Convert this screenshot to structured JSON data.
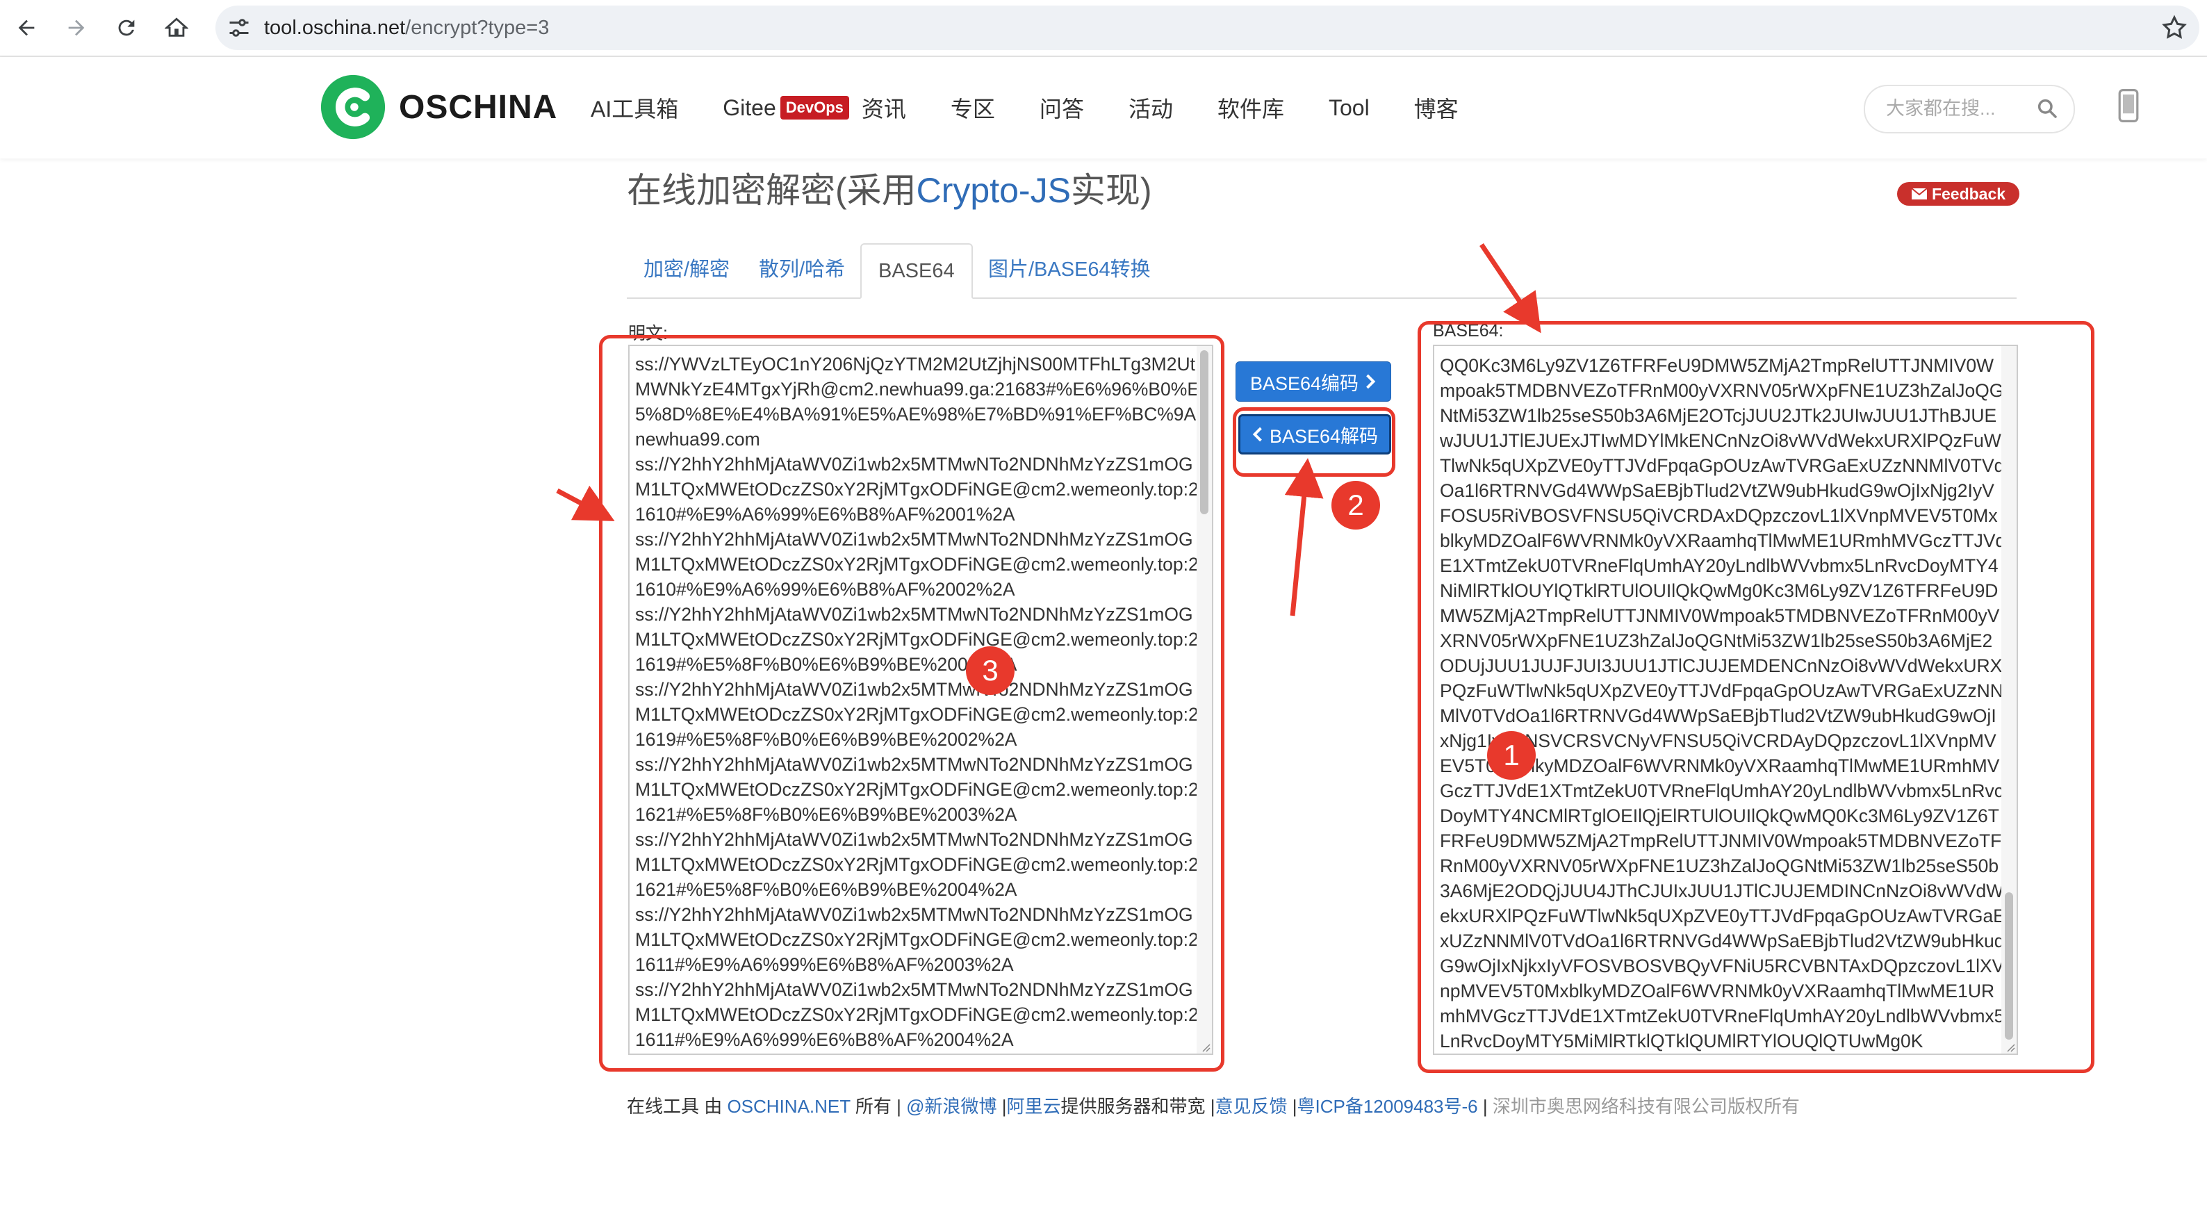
{
  "browser": {
    "url_host": "tool.oschina.net",
    "url_path": "/encrypt?type=3"
  },
  "site": {
    "logo_text": "OSCHINA",
    "nav": [
      {
        "label": "AI工具箱"
      },
      {
        "label": "Gitee",
        "badge": "DevOps"
      },
      {
        "label": "资讯"
      },
      {
        "label": "专区"
      },
      {
        "label": "问答"
      },
      {
        "label": "活动"
      },
      {
        "label": "软件库"
      },
      {
        "label": "Tool"
      },
      {
        "label": "博客"
      }
    ],
    "search_placeholder": "大家都在搜..."
  },
  "page": {
    "title_prefix": "在线加密解密(采用",
    "title_highlight": "Crypto-JS",
    "title_suffix": "实现)",
    "feedback_label": "Feedback",
    "tabs": [
      {
        "label": "加密/解密",
        "active": false
      },
      {
        "label": "散列/哈希",
        "active": false
      },
      {
        "label": "BASE64",
        "active": true
      },
      {
        "label": "图片/BASE64转换",
        "active": false
      }
    ],
    "plaintext_label": "明文:",
    "base64_label": "BASE64:",
    "encode_button": "BASE64编码",
    "decode_button": "BASE64解码",
    "plaintext_lines": [
      "ss://YWVzLTEyOC1nY206NjQzYTM2M2UtZjhjNS00MTFhLTg3M2Ut",
      "MWNkYzE4MTgxYjRh@cm2.newhua99.ga:21683#%E6%96%B0%E",
      "5%8D%8E%E4%BA%91%E5%AE%98%E7%BD%91%EF%BC%9A",
      "newhua99.com",
      "ss://Y2hhY2hhMjAtaWV0Zi1wb2x5MTMwNTo2NDNhMzYzZS1mOG",
      "M1LTQxMWEtODczZS0xY2RjMTgxODFiNGE@cm2.wemeonly.top:2",
      "1610#%E9%A6%99%E6%B8%AF%2001%2A",
      "ss://Y2hhY2hhMjAtaWV0Zi1wb2x5MTMwNTo2NDNhMzYzZS1mOG",
      "M1LTQxMWEtODczZS0xY2RjMTgxODFiNGE@cm2.wemeonly.top:2",
      "1610#%E9%A6%99%E6%B8%AF%2002%2A",
      "ss://Y2hhY2hhMjAtaWV0Zi1wb2x5MTMwNTo2NDNhMzYzZS1mOG",
      "M1LTQxMWEtODczZS0xY2RjMTgxODFiNGE@cm2.wemeonly.top:2",
      "1619#%E5%8F%B0%E6%B9%BE%2001%2A",
      "ss://Y2hhY2hhMjAtaWV0Zi1wb2x5MTMwNTo2NDNhMzYzZS1mOG",
      "M1LTQxMWEtODczZS0xY2RjMTgxODFiNGE@cm2.wemeonly.top:2",
      "1619#%E5%8F%B0%E6%B9%BE%2002%2A",
      "ss://Y2hhY2hhMjAtaWV0Zi1wb2x5MTMwNTo2NDNhMzYzZS1mOG",
      "M1LTQxMWEtODczZS0xY2RjMTgxODFiNGE@cm2.wemeonly.top:2",
      "1621#%E5%8F%B0%E6%B9%BE%2003%2A",
      "ss://Y2hhY2hhMjAtaWV0Zi1wb2x5MTMwNTo2NDNhMzYzZS1mOG",
      "M1LTQxMWEtODczZS0xY2RjMTgxODFiNGE@cm2.wemeonly.top:2",
      "1621#%E5%8F%B0%E6%B9%BE%2004%2A",
      "ss://Y2hhY2hhMjAtaWV0Zi1wb2x5MTMwNTo2NDNhMzYzZS1mOG",
      "M1LTQxMWEtODczZS0xY2RjMTgxODFiNGE@cm2.wemeonly.top:2",
      "1611#%E9%A6%99%E6%B8%AF%2003%2A",
      "ss://Y2hhY2hhMjAtaWV0Zi1wb2x5MTMwNTo2NDNhMzYzZS1mOG",
      "M1LTQxMWEtODczZS0xY2RjMTgxODFiNGE@cm2.wemeonly.top:2",
      "1611#%E9%A6%99%E6%B8%AF%2004%2A"
    ],
    "base64_lines": [
      "QQ0Kc3M6Ly9ZV1Z6TFRFeU9DMW5ZMjA2TmpRelUTTJNMIV0W",
      "mpoak5TMDBNVEZoTFRnM00yVXRNV05rWXpFNE1UZ3hZalJoQG",
      "NtMi53ZW1lb25seS50b3A6MjE2OTcjJUU2JTk2JUIwJUU1JThBJUE",
      "wJUU1JTlEJUExJTIwMDYlMkENCnNzOi8vWVdWekxURXlPQzFuW",
      "TlwNk5qUXpZVE0yTTJVdFpqaGpOUzAwTVRGaExUZzNNMlV0TVd",
      "Oa1l6RTRNVGd4WWpSaEBjbTlud2VtZW9ubHkudG9wOjIxNjg2IyV",
      "FOSU5RiVBOSVFNSU5QiVCRDAxDQpzczovL1lXVnpMVEV5T0Mx",
      "blkyMDZOalF6WVRNMk0yVXRaamhqTlMwME1URmhMVGczTTJVd",
      "E1XTmtZekU0TVRneFlqUmhAY20yLndlbWVvbmx5LnRvcDoyMTY4",
      "NiMlRTklOUYlQTklRTUlOUIlQkQwMg0Kc3M6Ly9ZV1Z6TFRFeU9D",
      "MW5ZMjA2TmpRelUTTJNMIV0Wmpoak5TMDBNVEZoTFRnM00yV",
      "XRNV05rWXpFNE1UZ3hZalJoQGNtMi53ZW1lb25seS50b3A6MjE2",
      "ODUjJUU1JUJFJUI3JUU1JTlCJUJEMDENCnNzOi8vWVdWekxURXl",
      "PQzFuWTlwNk5qUXpZVE0yTTJVdFpqaGpOUzAwTVRGaExUZzNN",
      "MlV0TVdOa1l6RTRNVGd4WWpSaEBjbTlud2VtZW9ubHkudG9wOjI",
      "xNjg1IyVFNSVCRSVCNyVFNSU5QiVCRDAyDQpzczovL1lXVnpMV",
      "EV5T0MxblkyMDZOalF6WVRNMk0yVXRaamhqTlMwME1URmhMV",
      "GczTTJVdE1XTmtZekU0TVRneFlqUmhAY20yLndlbWVvbmx5LnRvc",
      "DoyMTY4NCMlRTglOEIlQjElRTUlOUIlQkQwMQ0Kc3M6Ly9ZV1Z6T",
      "FRFeU9DMW5ZMjA2TmpRelUTTJNMIV0Wmpoak5TMDBNVEZoTF",
      "RnM00yVXRNV05rWXpFNE1UZ3hZalJoQGNtMi53ZW1lb25seS50b",
      "3A6MjE2ODQjJUU4JThCJUIxJUU1JTlCJUJEMDINCnNzOi8vWVdW",
      "ekxURXlPQzFuWTlwNk5qUXpZVE0yTTJVdFpqaGpOUzAwTVRGaE",
      "xUZzNNMlV0TVdOa1l6RTRNVGd4WWpSaEBjbTlud2VtZW9ubHkud",
      "G9wOjIxNjkxIyVFOSVBOSVBQyVFNiU5RCVBNTAxDQpzczovL1lXV",
      "npMVEV5T0MxblkyMDZOalF6WVRNMk0yVXRaamhqTlMwME1UR",
      "mhMVGczTTJVdE1XTmtZekU0TVRneFlqUmhAY20yLndlbWVvbmx5",
      "LnRvcDoyMTY5MiMlRTklQTklQUMlRTYlOUQlQTUwMg0K"
    ],
    "markers": [
      "1",
      "2",
      "3"
    ]
  },
  "footer": {
    "prefix": "在线工具 由 ",
    "oschina": "OSCHINA.NET",
    "owned": " 所有 | ",
    "weibo": "@新浪微博",
    "sep1": " |",
    "aliyun": "阿里云",
    "bandwidth": "提供服务器和带宽 |",
    "feedback": "意见反馈",
    "sep2": " |",
    "icp": "粤ICP备12009483号-6",
    "sep3": " | ",
    "copyright": "深圳市奥思网络科技有限公司版权所有"
  },
  "colors": {
    "accent_blue": "#2878d6",
    "annotation_red": "#e8392c",
    "logo_green": "#1fb25a"
  }
}
